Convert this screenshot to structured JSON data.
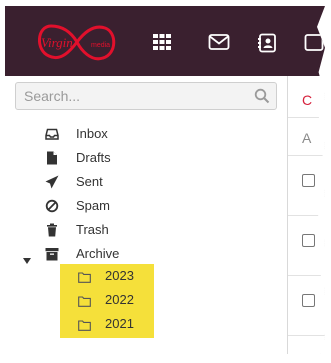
{
  "brand": {
    "logo_text": "Virgin media",
    "colors": {
      "topbar": "#3a202f",
      "logo_red": "#e1102c",
      "folder_highlight": "#f5e03a"
    }
  },
  "nav": {
    "icons": [
      "apps-grid-icon",
      "mail-icon",
      "contacts-icon",
      "calendar-icon"
    ]
  },
  "search": {
    "placeholder": "Search...",
    "value": ""
  },
  "folders": [
    {
      "label": "Inbox",
      "icon": "inbox-icon"
    },
    {
      "label": "Drafts",
      "icon": "drafts-icon"
    },
    {
      "label": "Sent",
      "icon": "sent-icon"
    },
    {
      "label": "Spam",
      "icon": "spam-icon"
    },
    {
      "label": "Trash",
      "icon": "trash-icon"
    },
    {
      "label": "Archive",
      "icon": "archive-icon",
      "expanded": true,
      "children": [
        {
          "label": "2023",
          "icon": "folder-icon"
        },
        {
          "label": "2022",
          "icon": "folder-icon"
        },
        {
          "label": "2021",
          "icon": "folder-icon"
        }
      ]
    }
  ],
  "content": {
    "top_truncated": "C",
    "header_truncated": "A",
    "rows": 3
  }
}
